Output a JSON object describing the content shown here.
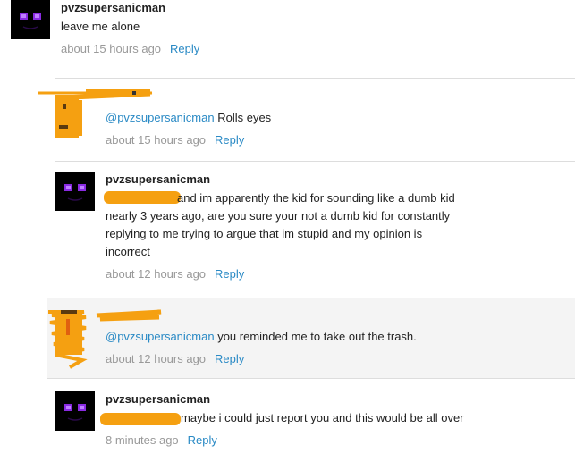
{
  "comments": [
    {
      "username": "pvzsupersanicman",
      "text": "leave me alone",
      "time": "about 15 hours ago",
      "reply_label": "Reply"
    },
    {
      "mention": "@pvzsupersanicman",
      "text": " Rolls eyes",
      "time": "about 15 hours ago",
      "reply_label": "Reply"
    },
    {
      "username": "pvzsupersanicman",
      "text": "and im apparently the kid for sounding like a dumb kid nearly 3 years ago, are you sure your not a dumb kid for constantly replying to me trying to argue that im stupid and my opinion is incorrect",
      "time": "about 12 hours ago",
      "reply_label": "Reply"
    },
    {
      "mention": "@pvzsupersanicman",
      "text": " you reminded me to take out the trash.",
      "time": "about 12 hours ago",
      "reply_label": "Reply"
    },
    {
      "username": "pvzsupersanicman",
      "text": "maybe i could just report you and this would be all over",
      "time": "8 minutes ago",
      "reply_label": "Reply"
    }
  ],
  "colors": {
    "link": "#2a8ac5",
    "meta": "#999999",
    "redaction": "#f5a011",
    "avatar_eyes": "#8a2be2"
  },
  "icons": {
    "enderman_avatar": "enderman-avatar-icon",
    "redacted_avatar": "redacted-avatar"
  }
}
